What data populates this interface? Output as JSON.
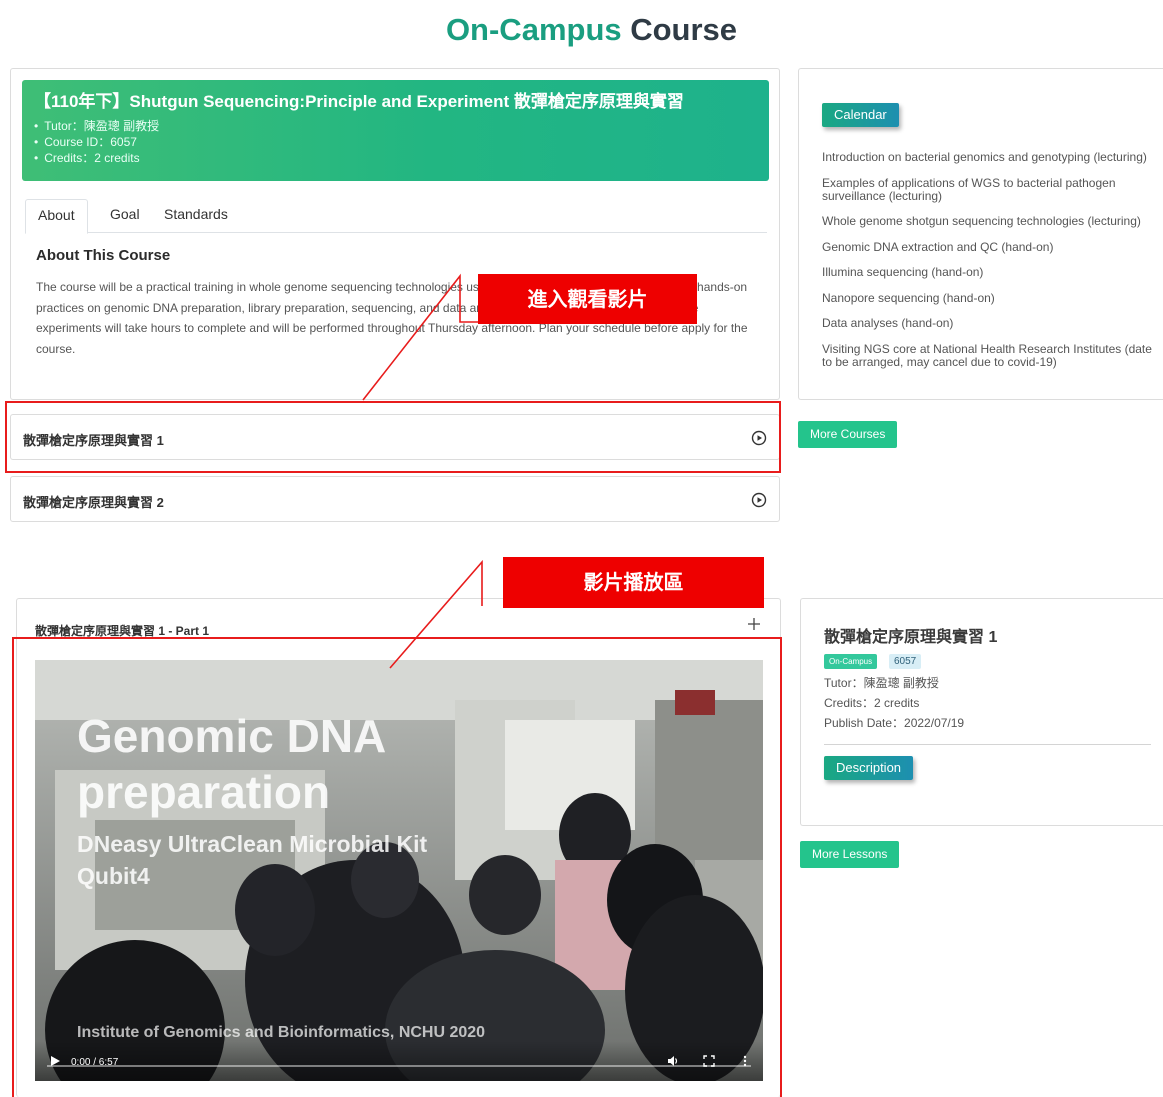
{
  "page": {
    "title_accent": "On-Campus",
    "title_rest": " Course"
  },
  "course": {
    "title": "【110年下】Shutgun Sequencing:Principle and Experiment 散彈槍定序原理與實習",
    "details": [
      "Tutor：陳盈璁 副教授",
      "Course ID：6057",
      "Credits：2 credits"
    ],
    "tabs": [
      "About",
      "Goal",
      "Standards"
    ],
    "about_heading": "About This Course",
    "about_text": "The course will be a practical training in whole genome sequencing technologies using bacterial genome. Students will have hands-on practices on genomic DNA preparation, library preparation, sequencing, and data analysis. Please be aware that some of the experiments will take hours to complete and will be performed throughout Thursday afternoon. Plan your schedule before apply for the course."
  },
  "lessons": [
    "散彈槍定序原理與實習 1",
    "散彈槍定序原理與實習 2"
  ],
  "calendar": {
    "label": "Calendar",
    "items": [
      "Introduction on bacterial genomics and genotyping (lecturing)",
      "Examples of applications of WGS to bacterial pathogen surveillance (lecturing)",
      "Whole genome shotgun sequencing technologies (lecturing)",
      "Genomic DNA extraction and QC (hand-on)",
      "Illumina sequencing (hand-on)",
      "Nanopore sequencing (hand-on)",
      "Data analyses (hand-on)",
      "Visiting NGS core at National Health Research Institutes (date to be arranged, may cancel due to covid-19)"
    ]
  },
  "more_courses": "More Courses",
  "player": {
    "heading": "散彈槍定序原理與實習 1 - Part 1",
    "video_title": "Genomic DNA preparation",
    "video_subtitle": "DNeasy UltraClean Microbial Kit",
    "video_subtitle2": "Qubit4",
    "video_credit": "Institute of Genomics and Bioinformatics, NCHU 2020",
    "time": "0:00 / 6:57",
    "progress": 0
  },
  "lesson_info": {
    "title": "散彈槍定序原理與實習 1",
    "badge_type": "On-Campus",
    "badge_id": "6057",
    "tutor": "Tutor：陳盈璁 副教授",
    "credits": "Credits：2 credits",
    "publish": "Publish Date：2022/07/19",
    "description_label": "Description"
  },
  "more_lessons": "More Lessons",
  "annotations": {
    "enter_video": "進入觀看影片",
    "player_area": "影片播放區",
    "color": "#e81c1c"
  },
  "colors": {
    "brand_green": "#1a9e80",
    "button_green": "#24c48c"
  }
}
